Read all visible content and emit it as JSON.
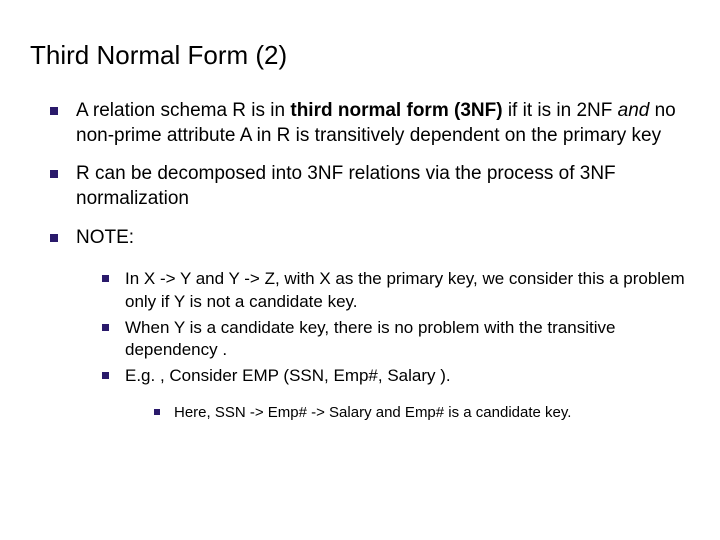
{
  "title": "Third Normal Form (2)",
  "items": [
    {
      "pre": "A relation schema R is in ",
      "bold": "third normal form (3NF)",
      "mid": " if it is in 2NF ",
      "italic": "and",
      "post": " no non-prime attribute A in R is transitively dependent on the primary key"
    },
    {
      "text": "R can be decomposed into 3NF relations via the process of 3NF normalization"
    },
    {
      "text": "NOTE:"
    }
  ],
  "subitems": [
    {
      "text": "In X -> Y and Y -> Z, with X as the primary key, we consider this a problem only if Y is not a candidate key."
    },
    {
      "text": "When Y is a candidate key, there is no problem with the transitive dependency ."
    },
    {
      "text": "E.g. , Consider EMP (SSN, Emp#, Salary )."
    }
  ],
  "subsubitems": [
    {
      "text": "Here, SSN -> Emp# -> Salary and Emp# is a candidate key."
    }
  ]
}
